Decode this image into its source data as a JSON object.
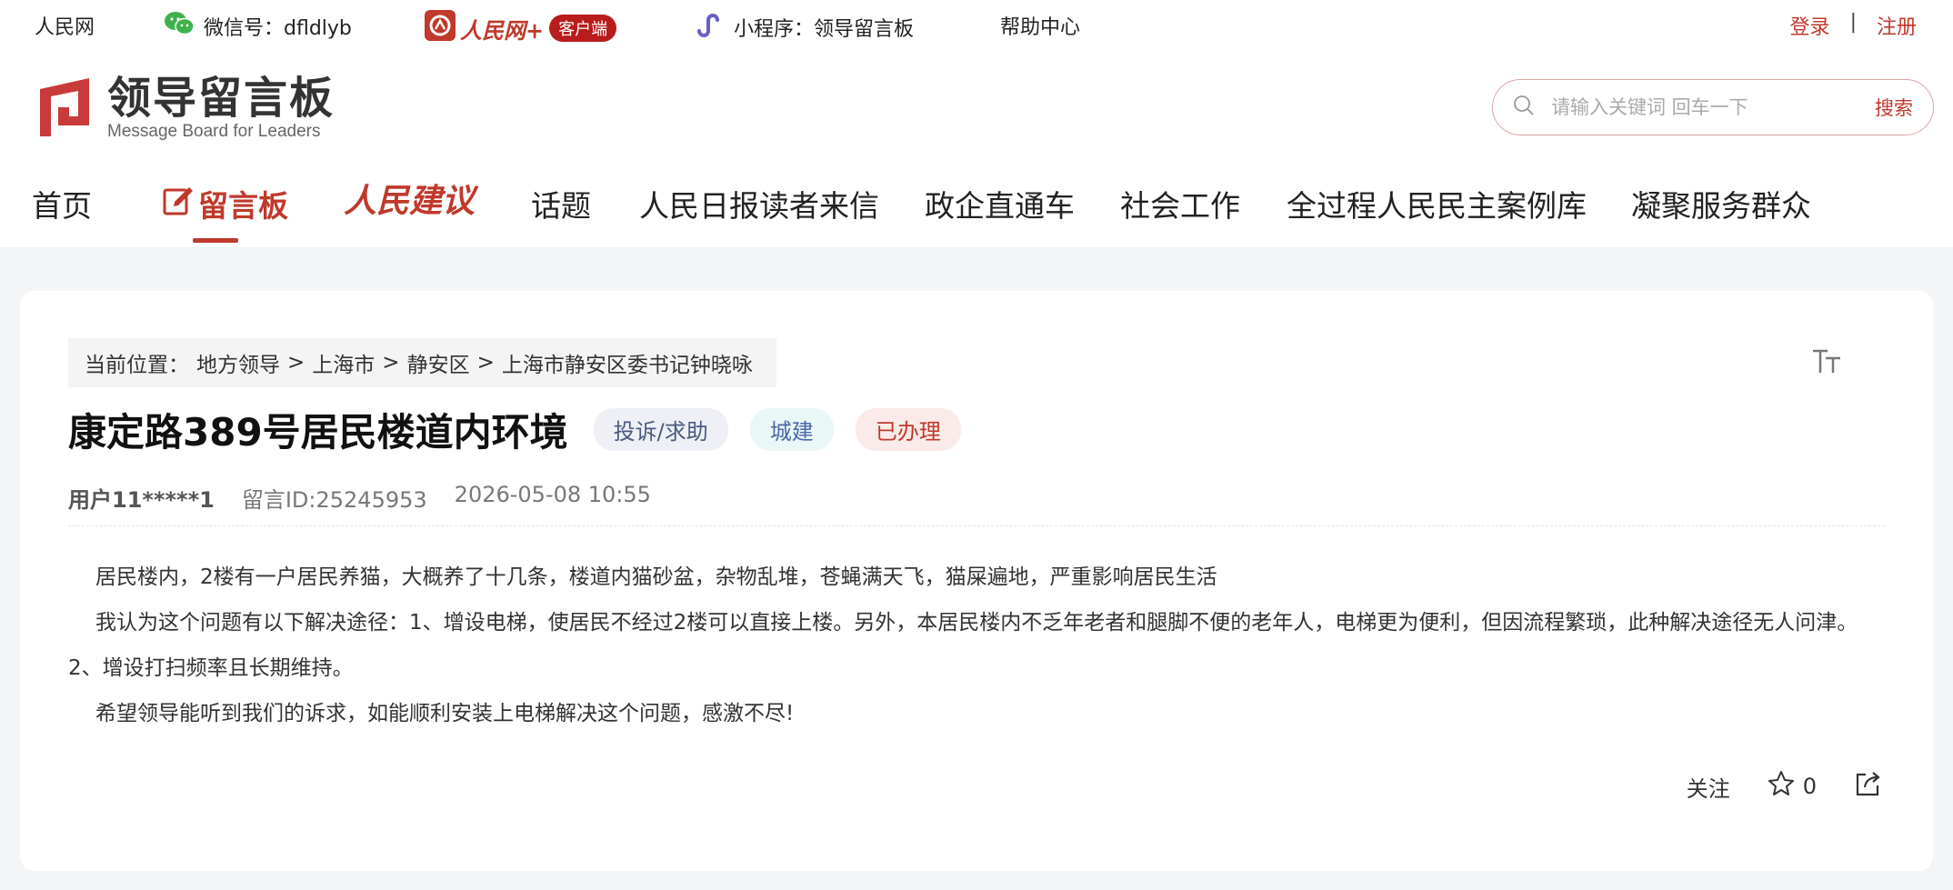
{
  "topbar": {
    "site": "人民网",
    "wechat": "微信号：dfldlyb",
    "client_logo": "人民网+",
    "client_badge": "客户端",
    "miniprogram": "小程序：领导留言板",
    "help": "帮助中心",
    "login": "登录",
    "sep": "|",
    "register": "注册"
  },
  "logo": {
    "cn": "领导留言板",
    "en": "Message Board for Leaders"
  },
  "search": {
    "placeholder": "请输入关键词 回车一下",
    "button": "搜索"
  },
  "nav": {
    "items": [
      "首页",
      "留言板",
      "人民建议",
      "话题",
      "人民日报读者来信",
      "政企直通车",
      "社会工作",
      "全过程人民民主案例库",
      "凝聚服务群众"
    ],
    "active_index": 1
  },
  "breadcrumb": {
    "prefix": "当前位置：",
    "levels": [
      "地方领导",
      "上海市",
      "静安区",
      "上海市静安区委书记钟晓咏"
    ],
    "sep": ">"
  },
  "message": {
    "title": "康定路389号居民楼道内环境",
    "tags": [
      "投诉/求助",
      "城建",
      "已办理"
    ],
    "user": "用户11*****1",
    "id": "留言ID:25245953",
    "time": "2026-05-08 10:55",
    "paragraphs": [
      "居民楼内，2楼有一户居民养猫，大概养了十几条，楼道内猫砂盆，杂物乱堆，苍蝇满天飞，猫屎遍地，严重影响居民生活",
      "我认为这个问题有以下解决途径：1、增设电梯，使居民不经过2楼可以直接上楼。另外，本居民楼内不乏年老者和腿脚不便的老年人，电梯更为便利，但因流程繁琐，此种解决途径无人问津。2、增设打扫频率且长期维持。",
      "希望领导能听到我们的诉求，如能顺利安装上电梯解决这个问题，感激不尽!"
    ]
  },
  "actions": {
    "follow": "关注",
    "star_count": "0"
  },
  "icons": [
    "wechat-icon",
    "people-logo-icon",
    "miniprogram-icon",
    "search-icon",
    "font-size-icon",
    "star-icon",
    "share-icon",
    "edit-icon"
  ],
  "colors": {
    "brand": "#c0392b",
    "logo_red": "#c93a3a",
    "wechat": "#3fb14a",
    "mini": "#6b5fc7"
  }
}
